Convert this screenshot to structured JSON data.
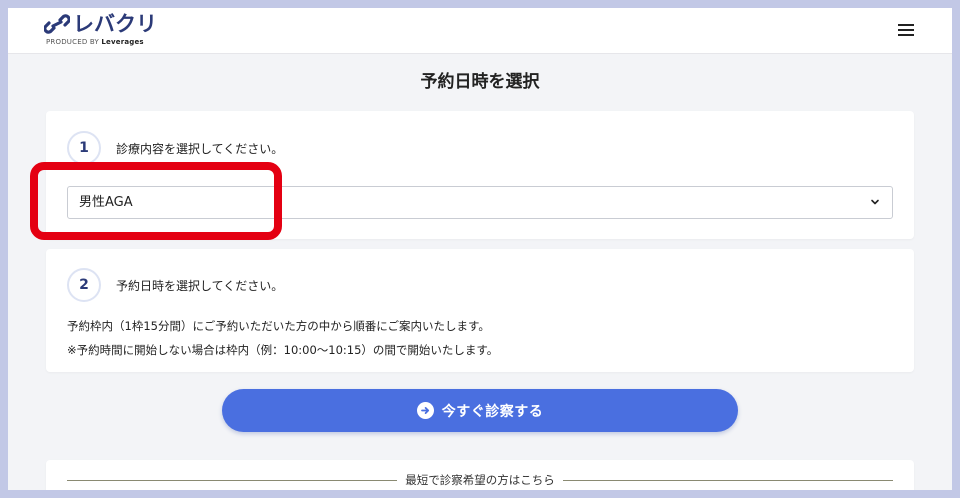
{
  "header": {
    "logo_text": "レバクリ",
    "logo_sub_prefix": "PRODUCED BY",
    "logo_sub_brand": "Leverages",
    "menu_icon": "hamburger-menu-icon"
  },
  "page": {
    "title": "予約日時を選択"
  },
  "step1": {
    "number": "1",
    "label": "診療内容を選択してください。",
    "select_value": "男性AGA",
    "select_icon": "chevron-down-icon"
  },
  "step2": {
    "number": "2",
    "label": "予約日時を選択してください。",
    "note1": "予約枠内（1枠15分間）にご予約いただいた方の中から順番にご案内いたします。",
    "note2": "※予約時間に開始しない場合は枠内（例：10:00〜10:15）の間で開始いたします。"
  },
  "cta": {
    "label": "今すぐ診察する",
    "icon": "arrow-right-circle-icon"
  },
  "section3": {
    "divider_text": "最短で診察希望の方はこちら"
  },
  "colors": {
    "brand_navy": "#2b3a78",
    "cta_blue": "#4a6fe0",
    "highlight_red": "#e40012"
  }
}
